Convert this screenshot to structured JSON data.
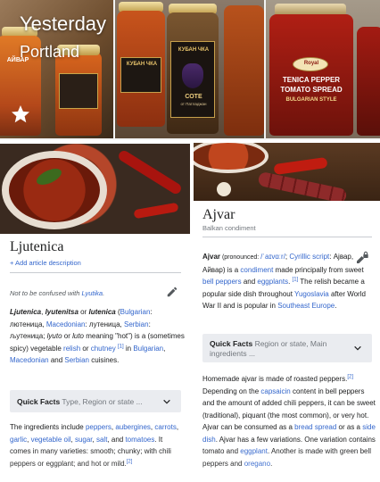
{
  "photos": {
    "day": "Yesterday",
    "location": "Portland",
    "jar_labels": {
      "left_jar": "АЙВАР",
      "mid_jar_top": "КУБАН ЧКА",
      "mid_jar_bottom": "СОТЕ",
      "mid_jar_bottom_sub": "от Патладжан",
      "right_jar_line1": "TENICA PEPPER",
      "right_jar_line2": "TOMATO SPREAD",
      "right_jar_line3": "BULGARIAN STYLE",
      "right_jar_brand": "Royal"
    },
    "icons": {
      "favorite": "star-icon"
    }
  },
  "ljutenica": {
    "title": "Ljutenica",
    "add_description": "+ Add article description",
    "hatnote_prefix": "Not to be confused with ",
    "hatnote_link": "Lyutika",
    "hatnote_suffix": ".",
    "p1": {
      "t1": "Ljutenica",
      "t2": ", ",
      "t3": "lyutenitsa",
      "t4": " or ",
      "t5": "lutenica",
      "t6": " (",
      "l_bulgarian": "Bulgarian",
      "t7": ": лютеница, ",
      "l_macedonian": "Macedonian",
      "t8": ": лутеница, ",
      "l_serbian": "Serbian",
      "t9": ": љутеница; ",
      "t10": "lyuto",
      "t11": " or ",
      "t12": "luto",
      "t13": " meaning \"hot\") is a (sometimes spicy) vegetable ",
      "l_relish": "relish",
      "t14": " or ",
      "l_chutney": "chutney",
      "ref1": "[1]",
      "t15": " in ",
      "l_bulgarian2": "Bulgarian",
      "t16": ", ",
      "l_macedonian2": "Macedonian",
      "t17": " and ",
      "l_serbian2": "Serbian",
      "t18": " cuisines."
    },
    "quick_facts": {
      "label": "Quick Facts",
      "hint": "Type, Region or state ..."
    },
    "p2": {
      "t1": "The ingredients include ",
      "l_peppers": "peppers",
      "t2": ", ",
      "l_aubergines": "aubergines",
      "t3": ", ",
      "l_carrots": "carrots",
      "t4": ", ",
      "l_garlic": "garlic",
      "t5": ", ",
      "l_oil": "vegetable oil",
      "t6": ", ",
      "l_sugar": "sugar",
      "t7": ", ",
      "l_salt": "salt",
      "t8": ", and ",
      "l_tomatoes": "tomatoes",
      "t9": ". It comes in many varieties: smooth; chunky; with chili peppers or eggplant; and hot or mild.",
      "ref2": "[2]"
    },
    "icons": {
      "edit": "pencil-icon"
    }
  },
  "ajvar": {
    "title": "Ajvar",
    "subtitle": "Balkan condiment",
    "p1": {
      "t1": "Ajvar",
      "t2": " (pronounced: ",
      "ipa": "/ˈaɪvɑːr/",
      "t3": "; ",
      "l_cyrillic": "Cyrillic script",
      "t4": ": Ајвар, Айвар) is a ",
      "l_condiment": "condiment",
      "t5": " made principally from sweet ",
      "l_bell": "bell peppers",
      "t6": " and ",
      "l_eggplants": "eggplants",
      "t7": ". ",
      "ref1": "[1]",
      "t8": " The relish became a popular side dish throughout ",
      "l_yugoslavia": "Yugoslavia",
      "t9": " after World War II and is popular in ",
      "l_see": "Southeast Europe",
      "t10": "."
    },
    "quick_facts": {
      "label": "Quick Facts",
      "hint": "Region or state, Main ingredients ..."
    },
    "p2": {
      "t1": "Homemade ajvar is made of roasted peppers.",
      "ref2": "[2]",
      "t2": " Depending on the ",
      "l_capsaicin": "capsaicin",
      "t3": " content in bell peppers and the amount of added chili peppers, it can be sweet (traditional), piquant (the most common), or very hot. Ajvar can be consumed as a ",
      "l_spread": "bread spread",
      "t4": " or as a ",
      "l_side": "side dish",
      "t5": ". Ajvar has a few variations. One variation contains tomato and ",
      "l_eggplant": "eggplant",
      "t6": ". Another is made with green bell peppers and ",
      "l_oregano": "oregano",
      "t7": "."
    },
    "icons": {
      "edit": "pencil-lock-icon"
    }
  }
}
